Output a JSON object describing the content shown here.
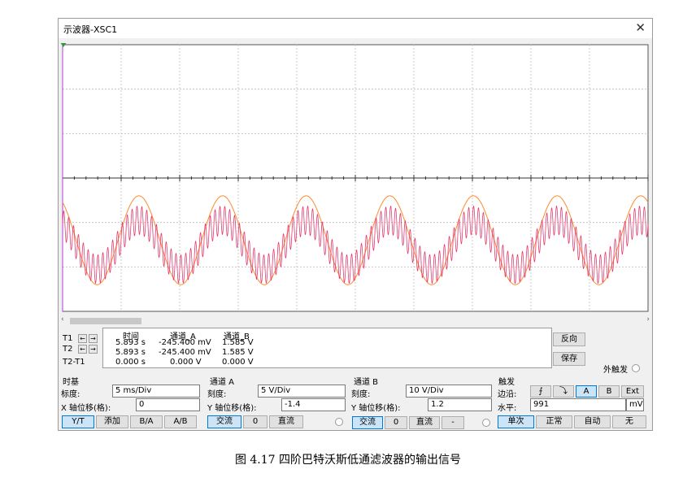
{
  "window": {
    "title": "示波器-XSC1",
    "close_icon": "✕"
  },
  "colors": {
    "channel_a": "#ff8a2a",
    "channel_b": "#e83a6e",
    "trigger_marker": "#2e9a3a",
    "cursor": "#b040d0",
    "selected": "#cce4f7"
  },
  "scope": {
    "channel_a_signal": {
      "cycles": 7,
      "offset_div": -1.4,
      "scale": "5 V/Div",
      "amplitude_div": 1.0
    },
    "channel_b_signal": {
      "cycles": 7,
      "offset_div": 1.2,
      "scale": "10 V/Div",
      "amplitude_div": 0.55,
      "ripple_cycles": 120,
      "ripple_div": 0.32
    }
  },
  "readout": {
    "t1_label": "T1",
    "t2_label": "T2",
    "t2t1_label": "T2-T1",
    "arrow_left": "←",
    "arrow_right": "→",
    "headers": {
      "time": "时间",
      "channel_a": "通道_A",
      "channel_b": "通道_B"
    },
    "rows": [
      {
        "time": "5.893 s",
        "a": "-245.400 mV",
        "b": "1.585 V"
      },
      {
        "time": "5.893 s",
        "a": "-245.400 mV",
        "b": "1.585 V"
      },
      {
        "time": "0.000 s",
        "a": "0.000 V",
        "b": "0.000 V"
      }
    ],
    "reverse_button": "反向",
    "save_button": "保存",
    "ext_trigger_label": "外触发"
  },
  "timebase": {
    "group_label": "时基",
    "scale_label": "标度:",
    "scale_value": "5 ms/Div",
    "xpos_label": "X 轴位移(格):",
    "xpos_value": "0",
    "modes": [
      "Y/T",
      "添加",
      "B/A",
      "A/B"
    ]
  },
  "channel_a": {
    "group_label": "通道 A",
    "scale_label": "刻度:",
    "scale_value": "5  V/Div",
    "ypos_label": "Y 轴位移(格):",
    "ypos_value": "-1.4",
    "coupling": [
      "交流",
      "0",
      "直流"
    ]
  },
  "channel_b": {
    "group_label": "通道 B",
    "scale_label": "刻度:",
    "scale_value": "10  V/Div",
    "ypos_label": "Y 轴位移(格):",
    "ypos_value": "1.2",
    "coupling": [
      "交流",
      "0",
      "直流",
      "-"
    ]
  },
  "trigger": {
    "group_label": "触发",
    "edge_label": "边沿:",
    "edge_rising": "⨍",
    "edge_falling": "⤵",
    "sources": [
      "A",
      "B",
      "Ext"
    ],
    "level_label": "水平:",
    "level_value": "991",
    "level_unit": "mV",
    "modes": [
      "单次",
      "正常",
      "自动",
      "无"
    ]
  },
  "caption": "图 4.17 四阶巴特沃斯低通滤波器的输出信号"
}
